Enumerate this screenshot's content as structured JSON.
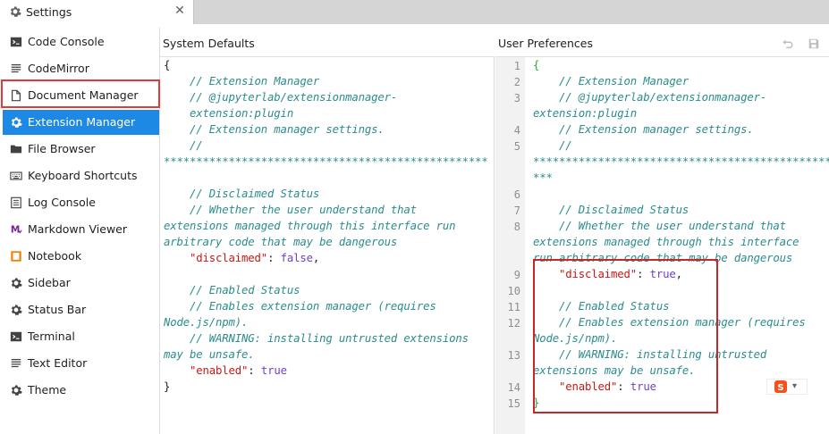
{
  "tab": {
    "title": "Settings",
    "close_glyph": "✕",
    "icon": "gear-icon"
  },
  "sidebar": {
    "items": [
      {
        "label": "Code Console",
        "icon": "terminal-icon"
      },
      {
        "label": "CodeMirror",
        "icon": "text-lines-icon"
      },
      {
        "label": "Document Manager",
        "icon": "file-icon"
      },
      {
        "label": "Extension Manager",
        "icon": "gear-icon",
        "active": true
      },
      {
        "label": "File Browser",
        "icon": "folder-icon"
      },
      {
        "label": "Keyboard Shortcuts",
        "icon": "keyboard-icon"
      },
      {
        "label": "Log Console",
        "icon": "list-icon"
      },
      {
        "label": "Markdown Viewer",
        "icon": "markdown-icon"
      },
      {
        "label": "Notebook",
        "icon": "notebook-icon"
      },
      {
        "label": "Sidebar",
        "icon": "gear-icon"
      },
      {
        "label": "Status Bar",
        "icon": "gear-icon"
      },
      {
        "label": "Terminal",
        "icon": "terminal-icon"
      },
      {
        "label": "Text Editor",
        "icon": "text-lines-icon"
      },
      {
        "label": "Theme",
        "icon": "gear-icon"
      }
    ]
  },
  "system_defaults": {
    "title": "System Defaults",
    "lines": [
      {
        "text": "{",
        "cls": "p"
      },
      {
        "text": "    // Extension Manager",
        "cls": "c"
      },
      {
        "text": "    // @jupyterlab/extensionmanager-",
        "cls": "c"
      },
      {
        "text": "    extension:plugin",
        "cls": "c"
      },
      {
        "text": "    // Extension manager settings.",
        "cls": "c"
      },
      {
        "text": "    //",
        "cls": "c"
      },
      {
        "text": "**************************************************",
        "cls": "c"
      },
      {
        "text": "",
        "cls": "p"
      },
      {
        "text": "    // Disclaimed Status",
        "cls": "c"
      },
      {
        "text": "    // Whether the user understand that",
        "cls": "c"
      },
      {
        "text": "extensions managed through this interface run",
        "cls": "c"
      },
      {
        "text": "arbitrary code that may be dangerous",
        "cls": "c"
      },
      {
        "text": "    \"disclaimed\": false,",
        "cls": "kv",
        "key": "\"disclaimed\"",
        "value": "false"
      },
      {
        "text": "",
        "cls": "p"
      },
      {
        "text": "    // Enabled Status",
        "cls": "c"
      },
      {
        "text": "    // Enables extension manager (requires",
        "cls": "c"
      },
      {
        "text": "Node.js/npm).",
        "cls": "c"
      },
      {
        "text": "    // WARNING: installing untrusted extensions",
        "cls": "c"
      },
      {
        "text": "may be unsafe.",
        "cls": "c"
      },
      {
        "text": "    \"enabled\": true",
        "cls": "kv",
        "key": "\"enabled\"",
        "value": "true"
      },
      {
        "text": "}",
        "cls": "p"
      }
    ]
  },
  "user_preferences": {
    "title": "User Preferences",
    "undo_icon": "undo-icon",
    "save_icon": "save-icon",
    "line_numbers": [
      "1",
      "2",
      "3",
      "",
      "4",
      "5",
      "",
      "6",
      "7",
      "8",
      "",
      "",
      "9",
      "10",
      "11",
      "12",
      "",
      "13",
      "",
      "14",
      "15"
    ],
    "lines": [
      {
        "text": "{",
        "cls": "br-g"
      },
      {
        "text": "    // Extension Manager",
        "cls": "c"
      },
      {
        "text": "    // @jupyterlab/extensionmanager-",
        "cls": "c"
      },
      {
        "text": "extension:plugin",
        "cls": "c"
      },
      {
        "text": "    // Extension manager settings.",
        "cls": "c"
      },
      {
        "text": "    //",
        "cls": "c"
      },
      {
        "text": "*************************************************",
        "cls": "c"
      },
      {
        "text": "***",
        "cls": "c"
      },
      {
        "text": "",
        "cls": "p"
      },
      {
        "text": "    // Disclaimed Status",
        "cls": "c"
      },
      {
        "text": "    // Whether the user understand that",
        "cls": "c"
      },
      {
        "text": "extensions managed through this interface",
        "cls": "c"
      },
      {
        "text": "run arbitrary code that may be dangerous",
        "cls": "c"
      },
      {
        "text": "    \"disclaimed\": true,",
        "cls": "kv",
        "key": "\"disclaimed\"",
        "value": "true"
      },
      {
        "text": "",
        "cls": "p"
      },
      {
        "text": "    // Enabled Status",
        "cls": "c"
      },
      {
        "text": "    // Enables extension manager (requires",
        "cls": "c"
      },
      {
        "text": "Node.js/npm).",
        "cls": "c"
      },
      {
        "text": "    // WARNING: installing untrusted",
        "cls": "c"
      },
      {
        "text": "extensions may be unsafe.",
        "cls": "c"
      },
      {
        "text": "    \"enabled\": true",
        "cls": "kv",
        "key": "\"enabled\"",
        "value": "true"
      },
      {
        "text": "}",
        "cls": "br-g"
      }
    ]
  },
  "colors": {
    "active_bg": "#1e88e5",
    "highlight_red": "#e53935",
    "comment": "#2c8c8c",
    "key": "#c41a16",
    "bool": "#6f42c1"
  }
}
